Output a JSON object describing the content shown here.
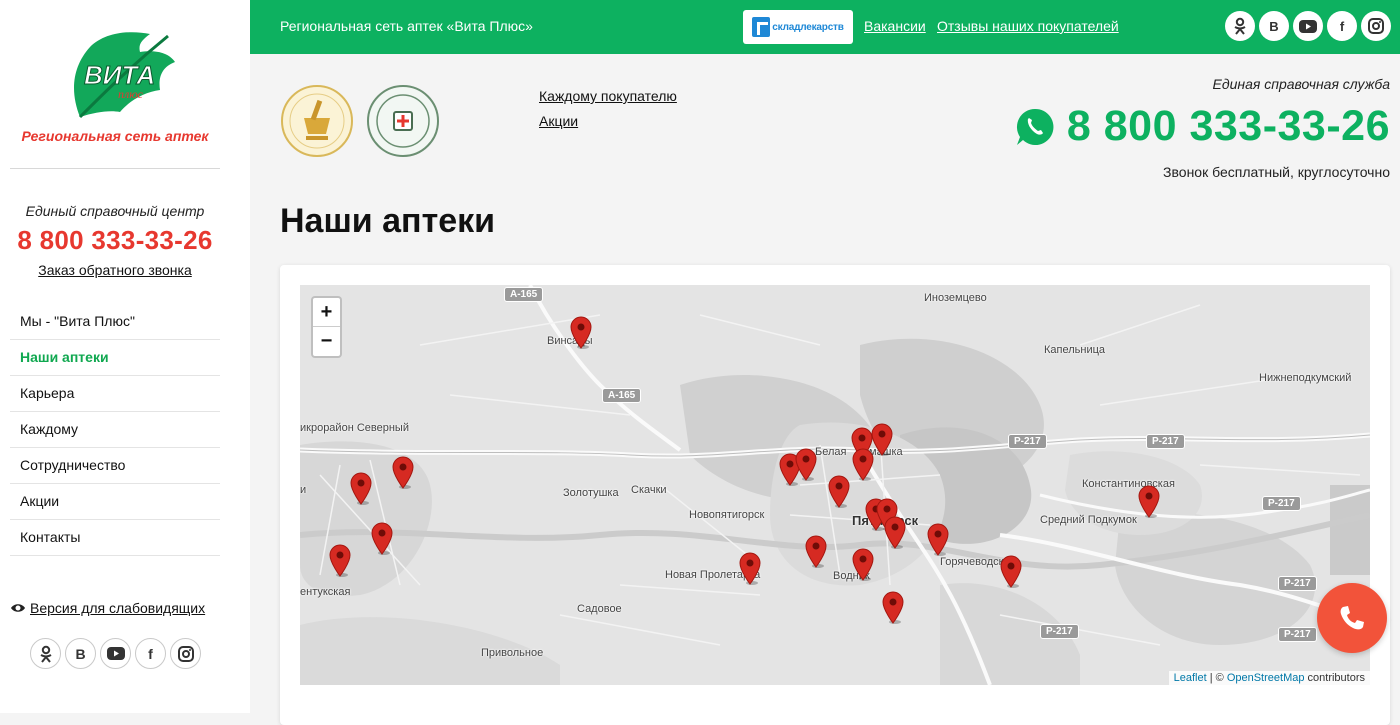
{
  "sidebar": {
    "logo_text": "ВИТА",
    "logo_sub": "плюс",
    "tagline": "Региональная сеть аптек",
    "contact_label": "Единый справочный центр",
    "phone": "8 800 333-33-26",
    "callback": "Заказ обратного звонка",
    "menu": [
      {
        "label": "Мы - \"Вита Плюс\"",
        "active": false
      },
      {
        "label": "Наши аптеки",
        "active": true
      },
      {
        "label": "Карьера",
        "active": false
      },
      {
        "label": "Каждому",
        "active": false
      },
      {
        "label": "Сотрудничество",
        "active": false
      },
      {
        "label": "Акции",
        "active": false
      },
      {
        "label": "Контакты",
        "active": false
      }
    ],
    "accessibility": "Версия для слабовидящих",
    "social": [
      "odnoklassniki-icon",
      "vk-icon",
      "youtube-icon",
      "facebook-icon",
      "instagram-icon"
    ]
  },
  "topbar": {
    "brand": "Региональная сеть аптек «Вита Плюс»",
    "sklad": "складлекарств",
    "vacancies": "Вакансии",
    "reviews": "Отзывы наших покупателей"
  },
  "header": {
    "link_each": "Каждому покупателю",
    "link_promos": "Акции",
    "hotline_label": "Единая справочная служба",
    "hotline_phone": "8 800 333-33-26",
    "hotline_note": "Звонок бесплатный, круглосуточно"
  },
  "main": {
    "title": "Наши аптеки"
  },
  "map": {
    "zoom_in": "+",
    "zoom_out": "−",
    "attrib_leaflet": "Leaflet",
    "attrib_sep": " | © ",
    "attrib_osm": "OpenStreetMap",
    "attrib_tail": " contributors",
    "places": {
      "inozemtsevo": "Иноземцево",
      "vinsady": "Винсады",
      "kapelnitsa": "Капельница",
      "nizhnepodkumsky": "Нижнеподкумский",
      "mikrorayon": "икрорайон Северный",
      "belaya": "Белая",
      "romashka": "машка",
      "zolotushka": "Золотушка",
      "skachki": "Скачки",
      "novopyatigorsk": "Новопятигорск",
      "pyatigorsk": "Пятигорск",
      "konstantinovskaya": "Константиновская",
      "sredny": "Средний Подкумок",
      "goryachevodsky": "Горячеводский",
      "vodnik": "Водник",
      "novaya_proletarka": "Новая Пролетарка",
      "sadovoe": "Садовое",
      "privolnoe": "Привольное",
      "entukskaya": "ентукская",
      "i_letter": "и"
    },
    "roads": {
      "a165_top": "А-165",
      "a165_mid": "А-165",
      "p217_a": "Р-217",
      "p217_b": "Р-217",
      "p217_c": "Р-217",
      "p217_d": "Р-217",
      "p217_e": "Р-217",
      "p217_f": "Р-217"
    }
  },
  "colors": {
    "green": "#0db160",
    "red": "#e7382f",
    "fab": "#f2533a"
  }
}
